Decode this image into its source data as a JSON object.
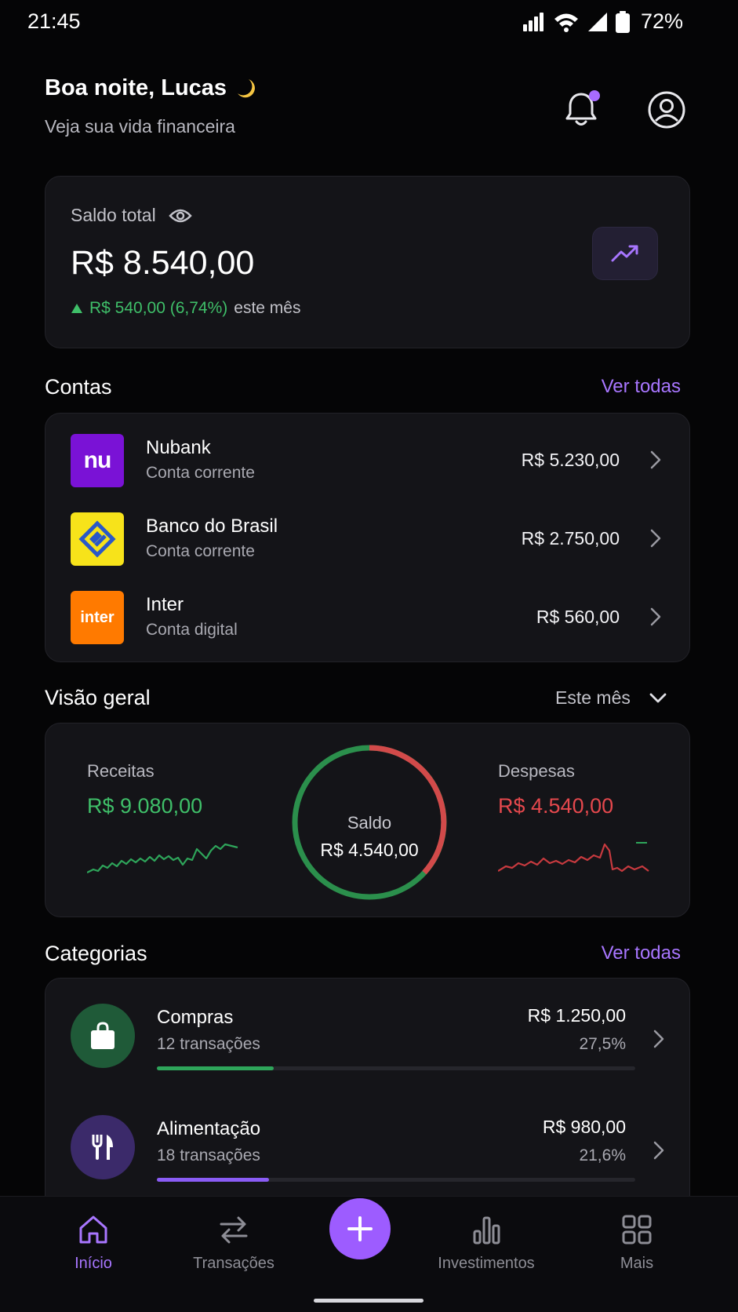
{
  "status_bar": {
    "time": "21:45",
    "battery": "72%"
  },
  "header": {
    "greeting": "Boa noite, Lucas",
    "subtitle": "Veja sua vida financeira",
    "notification_badge_color": "#a76bff"
  },
  "balance": {
    "label": "Saldo total",
    "value": "R$ 8.540,00",
    "change_value": "R$ 540,00 (6,74%)",
    "change_suffix": "este mês"
  },
  "accounts": {
    "title": "Contas",
    "link": "Ver todas",
    "items": [
      {
        "name": "Nubank",
        "type": "Conta corrente",
        "value": "R$ 5.230,00",
        "logo_text": "nu",
        "color": "#7a12d6"
      },
      {
        "name": "Banco do Brasil",
        "type": "Conta corrente",
        "value": "R$ 2.750,00",
        "logo_text": "",
        "color": "#f7e31a"
      },
      {
        "name": "Inter",
        "type": "Conta digital",
        "value": "R$ 560,00",
        "logo_text": "inter",
        "color": "#ff7a00"
      }
    ]
  },
  "overview": {
    "title": "Visão geral",
    "period": "Este mês",
    "income_label": "Receitas",
    "income_value": "R$ 9.080,00",
    "expense_label": "Despesas",
    "expense_value": "R$ 4.540,00",
    "balance_label": "Saldo",
    "balance_value": "R$ 4.540,00",
    "income_color": "#3fbf69",
    "expense_color": "#e5484d"
  },
  "categories": {
    "title": "Categorias",
    "link": "Ver todas",
    "items": [
      {
        "name": "Compras",
        "count": "12 transações",
        "amount": "R$ 1.250,00",
        "percent": "27,5%",
        "progress": 0.245,
        "icon": "shopping-bag-icon",
        "color": "#2ea55a",
        "bg": "#1f5a38"
      },
      {
        "name": "Alimentação",
        "count": "18 transações",
        "amount": "R$ 980,00",
        "percent": "21,6%",
        "progress": 0.235,
        "icon": "cutlery-icon",
        "color": "#8a5cf5",
        "bg": "#3b2a6a"
      }
    ]
  },
  "nav": {
    "items": [
      {
        "label": "Início",
        "icon": "home-icon"
      },
      {
        "label": "Transações",
        "icon": "transfer-icon"
      },
      {
        "label": "Investimentos",
        "icon": "bar-chart-icon"
      },
      {
        "label": "Mais",
        "icon": "grid-icon"
      }
    ],
    "fab_icon": "plus-icon",
    "accent": "#a876ff"
  }
}
